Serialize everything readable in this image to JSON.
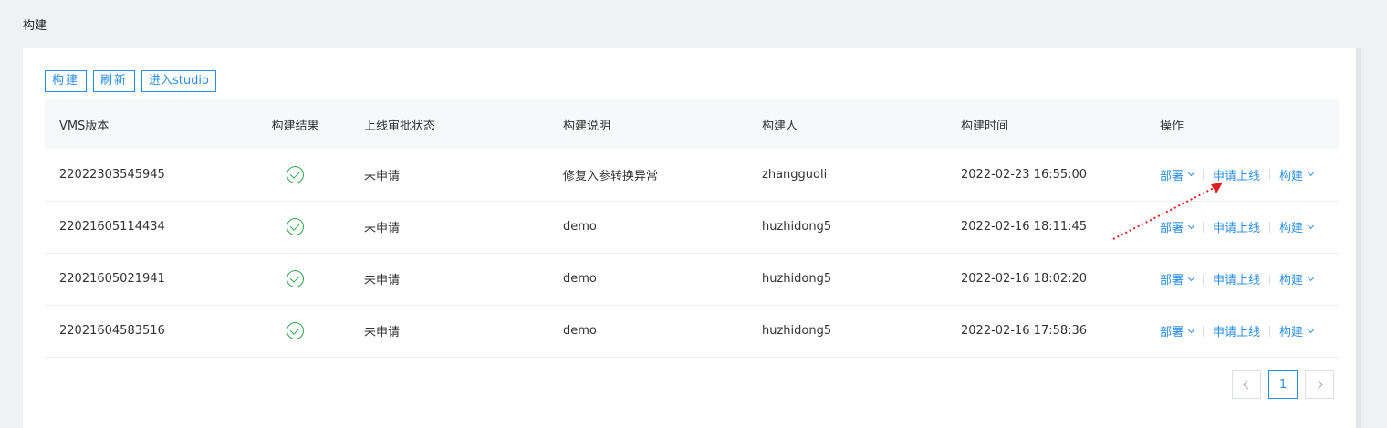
{
  "page_title": "构建",
  "toolbar": {
    "build_label": "构建",
    "refresh_label": "刷新",
    "studio_label": "进入studio"
  },
  "table": {
    "headers": [
      "VMS版本",
      "构建结果",
      "上线审批状态",
      "构建说明",
      "构建人",
      "构建时间",
      "操作"
    ],
    "rows": [
      {
        "version": "22022303545945",
        "result": "success",
        "approval": "未申请",
        "description": "修复入参转换异常",
        "builder": "zhangguoli",
        "time": "2022-02-23 16:55:00"
      },
      {
        "version": "22021605114434",
        "result": "success",
        "approval": "未申请",
        "description": "demo",
        "builder": "huzhidong5",
        "time": "2022-02-16 18:11:45"
      },
      {
        "version": "22021605021941",
        "result": "success",
        "approval": "未申请",
        "description": "demo",
        "builder": "huzhidong5",
        "time": "2022-02-16 18:02:20"
      },
      {
        "version": "22021604583516",
        "result": "success",
        "approval": "未申请",
        "description": "demo",
        "builder": "huzhidong5",
        "time": "2022-02-16 17:58:36"
      }
    ],
    "actions": {
      "deploy_label": "部署",
      "apply_online_label": "申请上线",
      "build_label": "构建"
    }
  },
  "pagination": {
    "current_page": "1"
  },
  "colors": {
    "accent": "#2b8ee8",
    "success": "#2aa84a",
    "annotation_arrow": "#e02020"
  },
  "icons": {
    "result": "check-circle-icon",
    "dropdown": "chevron-down-icon",
    "prev": "chevron-left-icon",
    "next": "chevron-right-icon"
  }
}
